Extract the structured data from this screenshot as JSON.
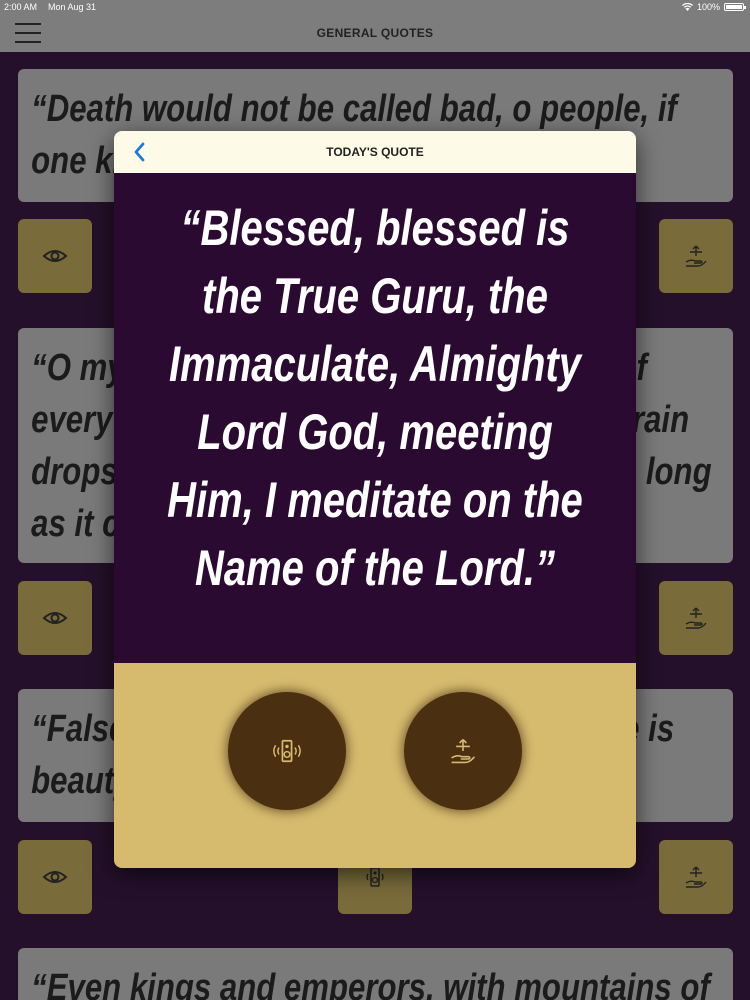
{
  "status_bar": {
    "time": "2:00 AM",
    "date": "Mon Aug 31",
    "battery": "100%"
  },
  "nav": {
    "title": "GENERAL QUOTES"
  },
  "cards": [
    {
      "text": "“Death would not be called bad, o people, if one knew how to truly die.”"
    },
    {
      "text": "“O my mind, the True Guru is the Giver of everything; He is like the rain drops, the rain drops fall and the thirsty are satisfied, as long as it can."
    },
    {
      "text": "“False is the body, false its clothes; false is beauty.”"
    },
    {
      "text": "“Even kings and emperors, with mountains of"
    }
  ],
  "modal": {
    "title": "TODAY'S QUOTE",
    "quote": "“Blessed, blessed is the True Guru, the Immaculate, Almighty Lord God, meeting Him, I meditate on the Name of the Lord.”"
  },
  "icons": {
    "eye": "eye-icon",
    "share": "share-hand-icon",
    "speaker": "speaker-icon",
    "back": "chevron-left-icon",
    "menu": "hamburger-icon"
  },
  "colors": {
    "nav": "#7d7d7d",
    "page_bg": "#24102a",
    "modal_body": "#2a0a30",
    "modal_footer": "#d6ba6e",
    "circle_button": "#4a2f10",
    "square_button": "#7a6b3a",
    "back_arrow": "#1a7ae0"
  }
}
